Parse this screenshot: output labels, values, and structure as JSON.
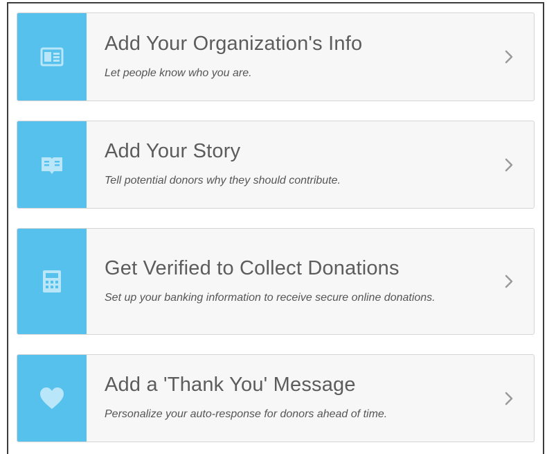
{
  "steps": [
    {
      "title": "Add Your Organization's Info",
      "subtitle": "Let people know who you are.",
      "icon": "id-card-icon"
    },
    {
      "title": "Add Your Story",
      "subtitle": "Tell potential donors why they should contribute.",
      "icon": "open-book-icon"
    },
    {
      "title": "Get Verified to Collect Donations",
      "subtitle": "Set up your banking information to receive secure online donations.",
      "icon": "calculator-icon"
    },
    {
      "title": "Add a 'Thank You' Message",
      "subtitle": "Personalize your auto-response for donors ahead of time.",
      "icon": "heart-icon"
    }
  ],
  "colors": {
    "accent": "#55c1ec",
    "card_bg": "#f7f7f7",
    "card_border": "#d5d5d5",
    "title_text": "#5c5c5c",
    "chevron": "#9a9a9a"
  }
}
